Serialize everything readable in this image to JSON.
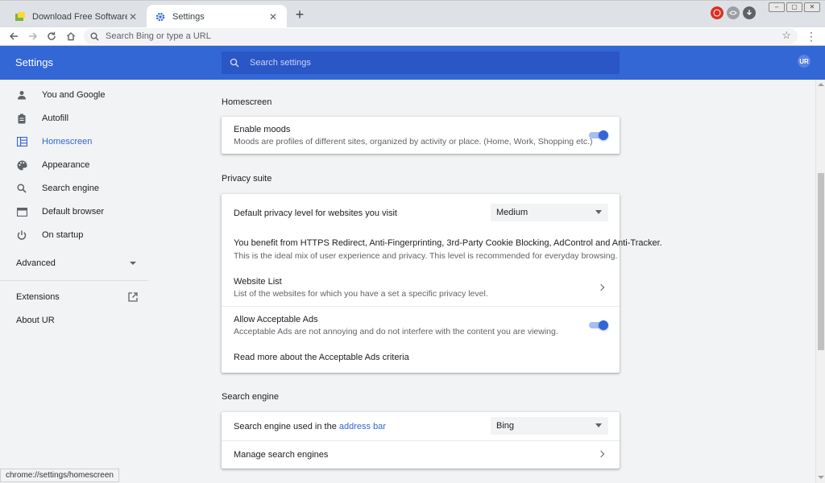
{
  "tabs": [
    {
      "title": "Download Free Software for Windows",
      "close": "✕"
    },
    {
      "title": "Settings",
      "close": "✕"
    }
  ],
  "newtab": "+",
  "toolbar": {
    "omnibox_placeholder": "Search Bing or type a URL"
  },
  "header": {
    "title": "Settings",
    "search_placeholder": "Search settings",
    "profile_badge": "UR"
  },
  "sidebar": {
    "items": [
      {
        "label": "You and Google",
        "icon": "person-icon"
      },
      {
        "label": "Autofill",
        "icon": "clipboard-icon"
      },
      {
        "label": "Homescreen",
        "icon": "grid-icon"
      },
      {
        "label": "Appearance",
        "icon": "palette-icon"
      },
      {
        "label": "Search engine",
        "icon": "search-icon"
      },
      {
        "label": "Default browser",
        "icon": "browser-icon"
      },
      {
        "label": "On startup",
        "icon": "power-icon"
      }
    ],
    "advanced": "Advanced",
    "extensions": "Extensions",
    "about": "About UR"
  },
  "homescreen": {
    "title": "Homescreen",
    "moods_label": "Enable moods",
    "moods_sub": "Moods are profiles of different sites, organized by activity or place. (Home, Work, Shopping etc.)",
    "moods_enabled": true
  },
  "privacy": {
    "title": "Privacy suite",
    "level_label": "Default privacy level for websites you visit",
    "level_value": "Medium",
    "benefit_line1": "You benefit from HTTPS Redirect, Anti-Fingerprinting, 3rd-Party Cookie Blocking, AdControl and Anti-Tracker.",
    "benefit_line2": "This is the ideal mix of user experience and privacy. This level is recommended for everyday browsing.",
    "website_list_label": "Website List",
    "website_list_sub": "List of the websites for which you have a set a specific privacy level.",
    "ads_label": "Allow Acceptable Ads",
    "ads_sub": "Acceptable Ads are not annoying and do not interfere with the content you are viewing.",
    "ads_enabled": true,
    "ads_link": "Read more about the Acceptable Ads criteria"
  },
  "search_engine": {
    "title": "Search engine",
    "used_label_prefix": "Search engine used in the ",
    "used_label_link": "address bar",
    "engine_value": "Bing",
    "manage_label": "Manage search engines"
  },
  "status_url": "chrome://settings/homescreen",
  "colors": {
    "accent": "#3367d6",
    "header": "#3367d6"
  }
}
